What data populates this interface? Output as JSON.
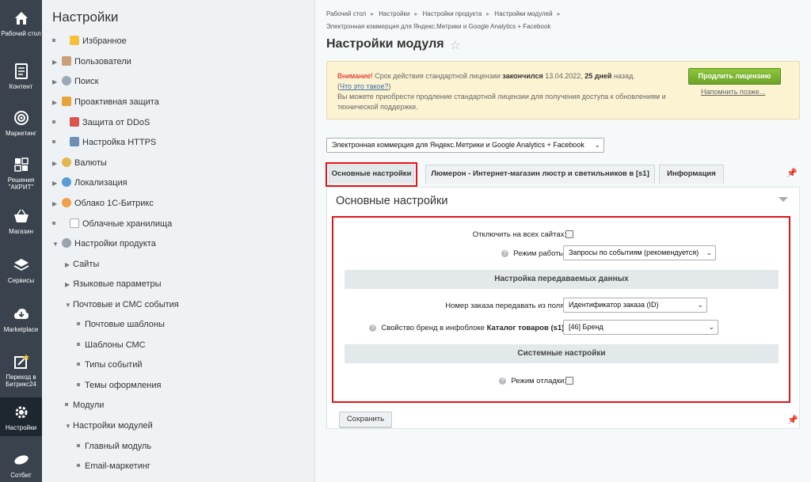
{
  "rail": {
    "items": [
      {
        "label": "Рабочий стол",
        "icon": "home-icon"
      },
      {
        "label": "Контент",
        "icon": "document-icon"
      },
      {
        "label": "Маркетинг",
        "icon": "target-icon"
      },
      {
        "label": "Решения \"АКРИТ\"",
        "icon": "puzzle-icon"
      },
      {
        "label": "Магазин",
        "icon": "basket-icon"
      },
      {
        "label": "Сервисы",
        "icon": "layers-icon"
      },
      {
        "label": "Marketplace",
        "icon": "cloud-icon"
      },
      {
        "label": "Переход в Битрикс24",
        "icon": "star-doc-icon"
      },
      {
        "label": "Настройки",
        "icon": "gear-icon"
      },
      {
        "label": "Сотбит",
        "icon": "leaf-icon"
      }
    ]
  },
  "menu": {
    "title": "Настройки",
    "items": [
      {
        "label": "Избранное"
      },
      {
        "label": "Пользователи"
      },
      {
        "label": "Поиск"
      },
      {
        "label": "Проактивная защита"
      },
      {
        "label": "Защита от DDoS"
      },
      {
        "label": "Настройка HTTPS"
      },
      {
        "label": "Валюты"
      },
      {
        "label": "Локализация"
      },
      {
        "label": "Облако 1С-Битрикс"
      },
      {
        "label": "Облачные хранилища"
      },
      {
        "label": "Настройки продукта"
      },
      {
        "label": "Сайты"
      },
      {
        "label": "Языковые параметры"
      },
      {
        "label": "Почтовые и СМС события"
      },
      {
        "label": "Почтовые шаблоны"
      },
      {
        "label": "Шаблоны СМС"
      },
      {
        "label": "Типы событий"
      },
      {
        "label": "Темы оформления"
      },
      {
        "label": "Модули"
      },
      {
        "label": "Настройки модулей"
      },
      {
        "label": "Главный модуль"
      },
      {
        "label": "Email-маркетинг"
      }
    ]
  },
  "breadcrumbs": {
    "c1": "Рабочий стол",
    "c2": "Настройки",
    "c3": "Настройки продукта",
    "c4": "Настройки модулей",
    "c5": "Электронная коммерция для Яндекс.Метрики и Google Analytics + Facebook"
  },
  "page": {
    "title": "Настройки модуля"
  },
  "alert": {
    "warn": "Внимание!",
    "t1": " Срок действия стандартной лицензии ",
    "expired": "закончился",
    "t2": " 13.04.2022, ",
    "days": "25 дней",
    "t3": " назад.",
    "link": "Что это такое?",
    "t4": "Вы можете приобрести продление стандартной лицензии для получения доступа к обновлениям и технической поддержке.",
    "button": "Продлить лицензию",
    "remind": "Напомнить позже..."
  },
  "module_select": {
    "value": "Электронная коммерция для Яндекс.Метрики и Google Analytics + Facebook"
  },
  "tabs": [
    {
      "label": "Основные настройки"
    },
    {
      "label": "Люмерон - Интернет-магазин люстр и светильников в [s1]"
    },
    {
      "label": "Информация"
    }
  ],
  "panel": {
    "title": "Основные настройки",
    "disable_all_label": "Отключить на всех сайтах:",
    "mode_label": "Режим работы:",
    "mode_value": "Запросы по событиям (рекомендуется)",
    "section_data": "Настройка передаваемых данных",
    "order_label": "Номер заказа передавать из поля:",
    "order_value": "Идентификатор заказа (ID)",
    "brand_label_prefix": "Свойство бренд в инфоблоке ",
    "brand_label_bold": "Каталог товаров (s1)",
    "brand_label_suffix": ":",
    "brand_value": "[46] Бренд",
    "section_system": "Системные настройки",
    "debug_label": "Режим отладки:",
    "save": "Сохранить"
  },
  "colors": {
    "rail_bg": "#3a424d",
    "accent_red": "#e0141a",
    "green_button": "#7bb431",
    "alert_bg": "#fcf3d2"
  }
}
